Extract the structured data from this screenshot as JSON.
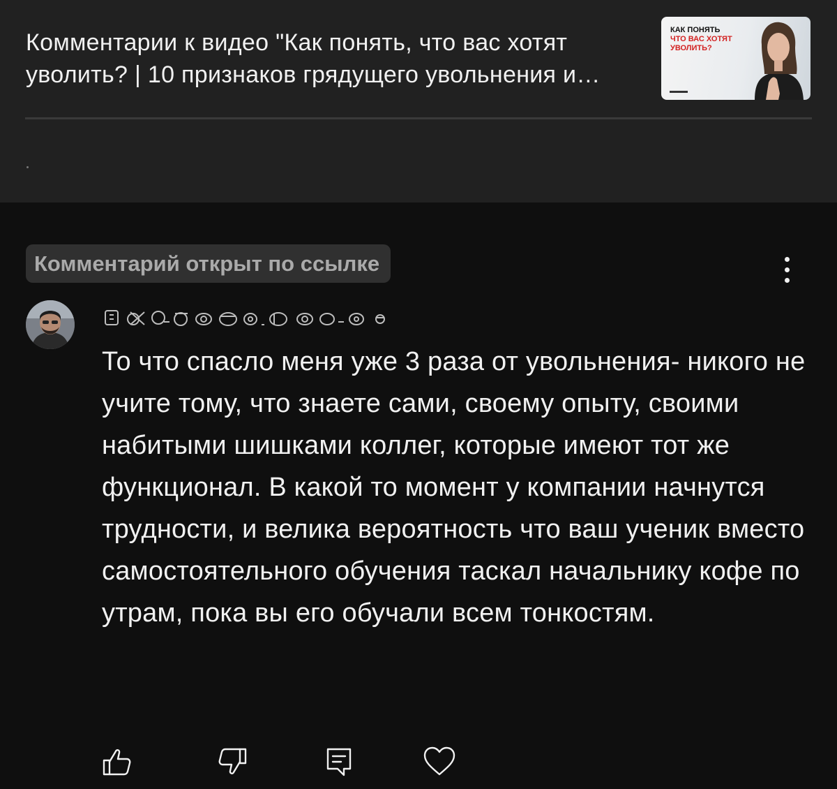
{
  "header": {
    "video_title": "Комментарии к видео \"Как понять, что вас хотят уволить? | 10 признаков грядущего увольнения и увольнения\"",
    "thumbnail": {
      "line1": "КАК ПОНЯТЬ",
      "line2": "ЧТО ВАС ХОТЯТ",
      "line3": "УВОЛИТЬ?"
    }
  },
  "comment": {
    "badge": "Комментарий открыт по ссылке",
    "text": "То что спасло меня уже 3 раза от увольнения- никого не учите тому, что знаете сами, своему опыту, своими набитыми шишками коллег, которые имеют тот же функционал. В какой то момент у компании начнутся трудности, и велика вероятность что ваш ученик вместо самостоятельного обучения таскал начальнику кофе по утрам, пока вы его обучали всем тонкостям."
  },
  "actions": {
    "icons": [
      "thumbs-up-icon",
      "thumbs-down-icon",
      "reply-icon",
      "heart-icon"
    ]
  },
  "colors": {
    "header_bg": "#212121",
    "page_bg": "#0f0f0f",
    "badge_bg": "#303030",
    "thumb_accent": "#d32222"
  }
}
